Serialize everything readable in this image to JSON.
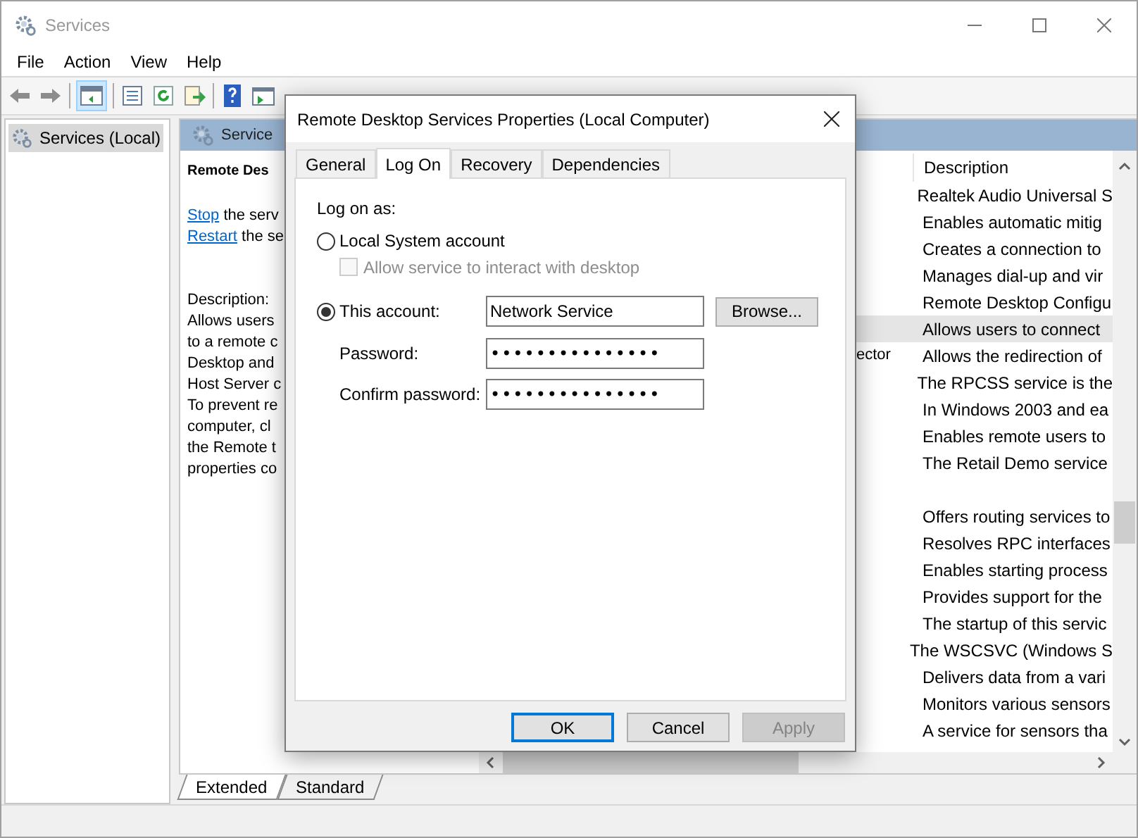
{
  "window": {
    "title": "Services"
  },
  "menu": [
    {
      "label": "File"
    },
    {
      "label": "Action"
    },
    {
      "label": "View"
    },
    {
      "label": "Help"
    }
  ],
  "tree": {
    "items": [
      {
        "label": "Services (Local)",
        "selected": true
      }
    ]
  },
  "pane_header": {
    "title": "Service"
  },
  "details": {
    "title": "Remote Des",
    "actions": [
      {
        "link": "Stop",
        "rest": " the serv"
      },
      {
        "link": "Restart",
        "rest": " the se"
      }
    ],
    "description_label": "Description:",
    "lines": [
      "Allows users",
      "to a remote c",
      "Desktop and",
      "Host Server c",
      "To prevent re",
      "computer, cl",
      "the Remote t",
      "properties co"
    ]
  },
  "list": {
    "columns": [
      {
        "label": "Description"
      }
    ],
    "rows": [
      {
        "description": "Realtek Audio Universal S",
        "selected": false
      },
      {
        "description": "Enables automatic mitig",
        "selected": false
      },
      {
        "description": "Creates a connection to",
        "selected": false
      },
      {
        "description": "Manages dial-up and vir",
        "selected": false
      },
      {
        "description": "Remote Desktop Configu",
        "selected": false
      },
      {
        "description": "Allows users to connect",
        "selected": true
      },
      {
        "column_3": "ector",
        "description": "Allows the redirection of",
        "selected": false
      },
      {
        "description": "The RPCSS service is the",
        "selected": false
      },
      {
        "description": "In Windows 2003 and ea",
        "selected": false
      },
      {
        "description": "Enables remote users to",
        "selected": false
      },
      {
        "description": "The Retail Demo service",
        "selected": false
      },
      {
        "selected": false
      },
      {
        "description": "Offers routing services to",
        "selected": false
      },
      {
        "description": "Resolves RPC interfaces",
        "selected": false
      },
      {
        "description": "Enables starting process",
        "selected": false
      },
      {
        "description": "Provides support for the",
        "selected": false
      },
      {
        "description": "The startup of this servic",
        "selected": false
      },
      {
        "description": "The WSCSVC (Windows S",
        "selected": false
      },
      {
        "description": "Delivers data from a vari",
        "selected": false
      },
      {
        "description": "Monitors various sensors",
        "selected": false
      },
      {
        "description": "A service for sensors tha",
        "selected": false
      }
    ]
  },
  "view_tabs": [
    {
      "label": "Extended",
      "selected": true
    },
    {
      "label": "Standard",
      "selected": false
    }
  ],
  "dialog": {
    "title": "Remote Desktop Services Properties (Local Computer)",
    "tabs": [
      {
        "label": "General",
        "selected": false
      },
      {
        "label": "Log On",
        "selected": true
      },
      {
        "label": "Recovery",
        "selected": false
      },
      {
        "label": "Dependencies",
        "selected": false
      }
    ],
    "log_on_as_label": "Log on as:",
    "options": [
      {
        "label": "Local System account",
        "selected": false
      },
      {
        "label": "This account:",
        "selected": true
      }
    ],
    "interact_checkbox": {
      "label": "Allow service to interact with desktop",
      "checked": false,
      "disabled": true
    },
    "account_field": {
      "value": "Network Service"
    },
    "browse_button": {
      "label": "Browse..."
    },
    "password": {
      "label": "Password:",
      "value": "•••••••••••••••"
    },
    "confirm_password": {
      "label": "Confirm password:",
      "value": "•••••••••••••••"
    },
    "buttons": [
      {
        "label": "OK",
        "kind": "default"
      },
      {
        "label": "Cancel",
        "kind": "normal"
      },
      {
        "label": "Apply",
        "kind": "disabled"
      }
    ]
  }
}
